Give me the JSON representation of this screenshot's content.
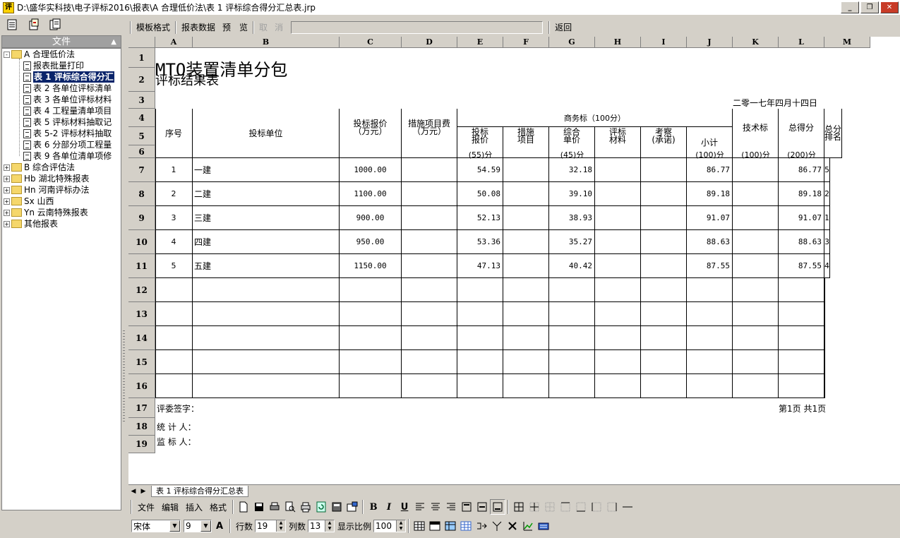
{
  "window": {
    "title": "D:\\盛华实科技\\电子评标2016\\报表\\A 合理低价法\\表 1 评标综合得分汇总表.jrp",
    "app_icon": "评"
  },
  "tree": {
    "header": "文件",
    "nodes": [
      {
        "label": "A 合理低价法",
        "type": "folder",
        "expand": "-"
      },
      {
        "label": "报表批量打印",
        "type": "doc"
      },
      {
        "label": "表 1 评标综合得分汇",
        "type": "doc",
        "selected": true
      },
      {
        "label": "表 2 各单位评标清单",
        "type": "doc"
      },
      {
        "label": "表 3 各单位评标材料",
        "type": "doc"
      },
      {
        "label": "表 4 工程量清单项目",
        "type": "doc"
      },
      {
        "label": "表 5 评标材料抽取记",
        "type": "doc"
      },
      {
        "label": "表 5-2 评标材料抽取",
        "type": "doc"
      },
      {
        "label": "表 6 分部分项工程量",
        "type": "doc"
      },
      {
        "label": "表 9 各单位清单项修",
        "type": "doc"
      },
      {
        "label": "B 综合评估法",
        "type": "folder",
        "expand": "+"
      },
      {
        "label": "Hb 湖北特殊报表",
        "type": "folder",
        "expand": "+"
      },
      {
        "label": "Hn 河南评标办法",
        "type": "folder",
        "expand": "+"
      },
      {
        "label": "Sx 山西",
        "type": "folder",
        "expand": "+"
      },
      {
        "label": "Yn 云南特殊报表",
        "type": "folder",
        "expand": "+"
      },
      {
        "label": "其他报表",
        "type": "folder",
        "expand": "+"
      }
    ]
  },
  "top_toolbar": {
    "template": "模板格式",
    "data": "报表数据",
    "preview": "预　览",
    "take": "取",
    "cancel": "消",
    "back": "返回"
  },
  "sheet": {
    "cols": [
      "A",
      "B",
      "C",
      "D",
      "E",
      "F",
      "G",
      "H",
      "I",
      "J",
      "K",
      "L",
      "M"
    ],
    "rows": [
      "1",
      "2",
      "3",
      "4",
      "5",
      "6",
      "7",
      "8",
      "9",
      "10",
      "11",
      "12",
      "13",
      "14",
      "15",
      "16",
      "17",
      "18",
      "19"
    ],
    "title": "MTO装置清单分包",
    "subtitle": "评标结果表",
    "date": "二零一七年四月十四日",
    "headers": {
      "seq": "序号",
      "unit": "投标单位",
      "bid": "投标报价\n（万元）",
      "measure": "措施项目费\n（万元）",
      "business": "商务标（100分）",
      "bid_price": "投标\n报价",
      "measure_item": "措施\n项目",
      "unit_price": "综合\n单价",
      "eval_mat": "评标\n材料",
      "inspect": "考察\n(承诺)",
      "subtotal": "小计",
      "bid_price_pts": "(55)分",
      "unit_price_pts": "(45)分",
      "subtotal_pts": "(100)分",
      "tech": "技术标",
      "tech_pts": "(100)分",
      "total": "总得分",
      "total_pts": "(200)分",
      "rank": "总分\n排名"
    },
    "rows_data": [
      {
        "seq": "1",
        "unit": "一建",
        "bid": "1000.00",
        "e": "54.59",
        "g": "32.18",
        "j": "86.77",
        "l": "86.77",
        "rank": "5"
      },
      {
        "seq": "2",
        "unit": "二建",
        "bid": "1100.00",
        "e": "50.08",
        "g": "39.10",
        "j": "89.18",
        "l": "89.18",
        "rank": "2"
      },
      {
        "seq": "3",
        "unit": "三建",
        "bid": "900.00",
        "e": "52.13",
        "g": "38.93",
        "j": "91.07",
        "l": "91.07",
        "rank": "1"
      },
      {
        "seq": "4",
        "unit": "四建",
        "bid": "950.00",
        "e": "53.36",
        "g": "35.27",
        "j": "88.63",
        "l": "88.63",
        "rank": "3"
      },
      {
        "seq": "5",
        "unit": "五建",
        "bid": "1150.00",
        "e": "47.13",
        "g": "40.42",
        "j": "87.55",
        "l": "87.55",
        "rank": "4"
      }
    ],
    "footer": {
      "judges": "评委签字：",
      "counter": "统 计 人：",
      "supervisor": "监 标 人：",
      "page": "第1页  共1页"
    }
  },
  "sheet_tab": "表 1 评标综合得分汇总表",
  "bottom_menu": [
    "文件",
    "编辑",
    "插入",
    "格式"
  ],
  "font": {
    "name": "宋体",
    "size": "9",
    "bold_a": "A"
  },
  "grid_ctrl": {
    "rows_label": "行数",
    "rows": "19",
    "cols_label": "列数",
    "cols": "13",
    "zoom_label": "显示比例",
    "zoom": "100"
  }
}
